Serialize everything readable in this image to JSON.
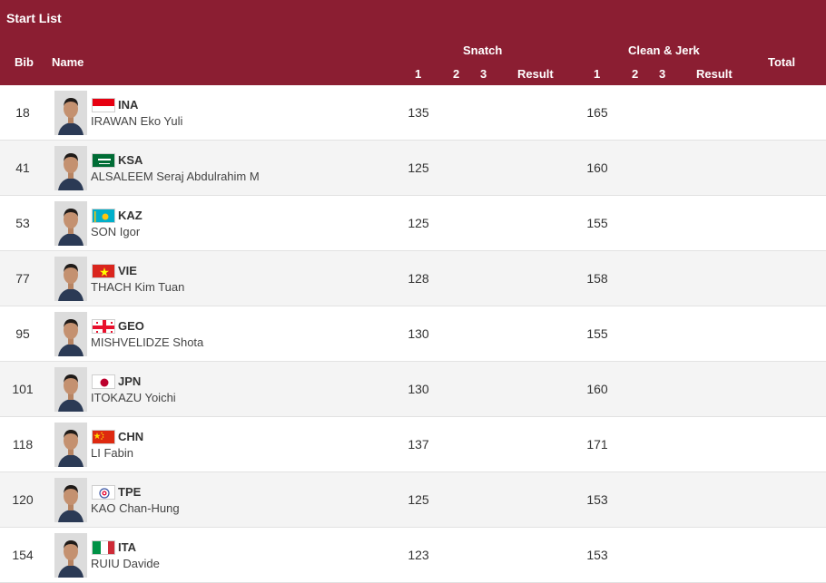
{
  "header": {
    "title": "Start List",
    "bib": "Bib",
    "name": "Name",
    "snatch": "Snatch",
    "clean_jerk": "Clean & Jerk",
    "total": "Total",
    "att1": "1",
    "att2": "2",
    "att3": "3",
    "result": "Result",
    "background_color": "#8b1e32"
  },
  "rows": [
    {
      "bib": "18",
      "noc": "INA",
      "name": "IRAWAN Eko Yuli",
      "snatch1": "135",
      "cj1": "165",
      "flag": "flag-indonesia"
    },
    {
      "bib": "41",
      "noc": "KSA",
      "name": "ALSALEEM Seraj Abdulrahim M",
      "snatch1": "125",
      "cj1": "160",
      "flag": "flag-saudi-arabia"
    },
    {
      "bib": "53",
      "noc": "KAZ",
      "name": "SON Igor",
      "snatch1": "125",
      "cj1": "155",
      "flag": "flag-kazakhstan"
    },
    {
      "bib": "77",
      "noc": "VIE",
      "name": "THACH Kim Tuan",
      "snatch1": "128",
      "cj1": "158",
      "flag": "flag-vietnam"
    },
    {
      "bib": "95",
      "noc": "GEO",
      "name": "MISHVELIDZE Shota",
      "snatch1": "130",
      "cj1": "155",
      "flag": "flag-georgia"
    },
    {
      "bib": "101",
      "noc": "JPN",
      "name": "ITOKAZU Yoichi",
      "snatch1": "130",
      "cj1": "160",
      "flag": "flag-japan"
    },
    {
      "bib": "118",
      "noc": "CHN",
      "name": "LI Fabin",
      "snatch1": "137",
      "cj1": "171",
      "flag": "flag-china"
    },
    {
      "bib": "120",
      "noc": "TPE",
      "name": "KAO Chan-Hung",
      "snatch1": "125",
      "cj1": "153",
      "flag": "flag-chinese-taipei"
    },
    {
      "bib": "154",
      "noc": "ITA",
      "name": "RUIU Davide",
      "snatch1": "123",
      "cj1": "153",
      "flag": "flag-italy"
    }
  ]
}
